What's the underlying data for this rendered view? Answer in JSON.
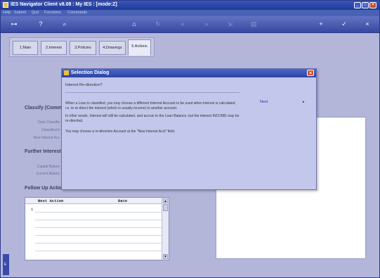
{
  "window": {
    "title": "IES Navigator Client v8.08 : My IES :      [mode:Z]"
  },
  "menu": [
    "Help",
    "Submit",
    "Quit",
    "Functions",
    "Commands"
  ],
  "toolbar": {
    "icons": [
      "key-icon",
      "help-icon",
      "search-icon",
      "home-icon",
      "refresh-icon",
      "rewind-icon",
      "forward-icon",
      "export-icon",
      "print-icon",
      "add-icon",
      "confirm-icon",
      "cancel-icon"
    ]
  },
  "tabs": [
    {
      "label": "1.Main"
    },
    {
      "label": "2.Interest"
    },
    {
      "label": "3.Policies"
    },
    {
      "label": "4.Drawings"
    },
    {
      "label": "5.Actions"
    }
  ],
  "sections": {
    "classify": "Classify (Comm",
    "further": "Further Interest",
    "follow": "Follow Up Actio"
  },
  "labels": {
    "date_classified": "Date Classifie",
    "classified_by": "Classified b",
    "new_interest": "New Interest Acc",
    "capital_balance": "Capital Balanc",
    "current_balance": "Current Balanc"
  },
  "grid": {
    "col_action": "Next Action",
    "col_date": "Date",
    "row1": "1"
  },
  "dialog": {
    "title": "Selection Dialog",
    "subtitle": "Interest Re-direction?",
    "para1": "When a Loan is classified, you may choose a different Interest Account to be used when interest is calculated, i.e. to re-direct the interest (which is usually income) to another account.",
    "para2": "In other words, Interest will still be calculated, and accrue to the Loan Balance, but the interest INCOME may be re-directed.",
    "para3": "You may choose a re-direction Account at the \"New Interest Acct\" field.",
    "next_label": "Next",
    "arrow": "▸"
  },
  "status": {
    "left": "E"
  }
}
